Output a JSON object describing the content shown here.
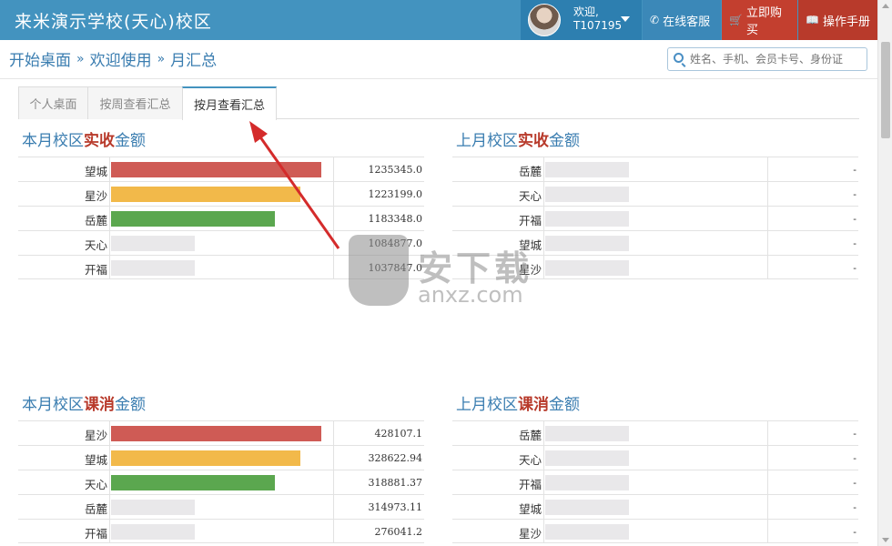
{
  "header": {
    "title": "来米演示学校(天心)校区",
    "welcome_line1": "欢迎,",
    "welcome_line2": "T107195",
    "buttons": {
      "service": "在线客服",
      "buy": "立即购买",
      "manual": "操作手册"
    }
  },
  "breadcrumb": {
    "items": [
      "开始桌面",
      "欢迎使用",
      "月汇总"
    ],
    "separator": "»"
  },
  "search": {
    "placeholder": "姓名、手机、会员卡号、身份证"
  },
  "tabs": [
    {
      "label": "个人桌面",
      "active": false
    },
    {
      "label": "按周查看汇总",
      "active": false
    },
    {
      "label": "按月查看汇总",
      "active": true
    }
  ],
  "colors": {
    "rank1": "#cf5b55",
    "rank2": "#f2b94a",
    "rank3": "#5ba74f",
    "empty": "#e9e8ea"
  },
  "panels": {
    "this_month_actual": {
      "title_pre": "本月校区",
      "title_hl": "实收",
      "title_post": "金额",
      "rows": [
        {
          "name": "望城",
          "value": "1235345.0",
          "level": 1.0,
          "rank": 1
        },
        {
          "name": "星沙",
          "value": "1223199.0",
          "level": 0.9,
          "rank": 2
        },
        {
          "name": "岳麓",
          "value": "1183348.0",
          "level": 0.78,
          "rank": 3
        },
        {
          "name": "天心",
          "value": "1084877.0",
          "level": 0.4,
          "rank": 0
        },
        {
          "name": "开福",
          "value": "1037847.0",
          "level": 0.4,
          "rank": 0
        }
      ]
    },
    "last_month_actual": {
      "title_pre": "上月校区",
      "title_hl": "实收",
      "title_post": "金额",
      "rows": [
        {
          "name": "岳麓",
          "value": "-",
          "level": 0.4,
          "rank": 0
        },
        {
          "name": "天心",
          "value": "-",
          "level": 0.4,
          "rank": 0
        },
        {
          "name": "开福",
          "value": "-",
          "level": 0.4,
          "rank": 0
        },
        {
          "name": "望城",
          "value": "-",
          "level": 0.4,
          "rank": 0
        },
        {
          "name": "星沙",
          "value": "-",
          "level": 0.4,
          "rank": 0
        }
      ]
    },
    "this_month_consume": {
      "title_pre": "本月校区",
      "title_hl": "课消",
      "title_post": "金额",
      "rows": [
        {
          "name": "星沙",
          "value": "428107.1",
          "level": 1.0,
          "rank": 1
        },
        {
          "name": "望城",
          "value": "328622.94",
          "level": 0.9,
          "rank": 2
        },
        {
          "name": "天心",
          "value": "318881.37",
          "level": 0.78,
          "rank": 3
        },
        {
          "name": "岳麓",
          "value": "314973.11",
          "level": 0.4,
          "rank": 0
        },
        {
          "name": "开福",
          "value": "276041.2",
          "level": 0.4,
          "rank": 0
        }
      ]
    },
    "last_month_consume": {
      "title_pre": "上月校区",
      "title_hl": "课消",
      "title_post": "金额",
      "rows": [
        {
          "name": "岳麓",
          "value": "-",
          "level": 0.4,
          "rank": 0
        },
        {
          "name": "天心",
          "value": "-",
          "level": 0.4,
          "rank": 0
        },
        {
          "name": "开福",
          "value": "-",
          "level": 0.4,
          "rank": 0
        },
        {
          "name": "望城",
          "value": "-",
          "level": 0.4,
          "rank": 0
        },
        {
          "name": "星沙",
          "value": "-",
          "level": 0.4,
          "rank": 0
        }
      ]
    }
  },
  "watermark": {
    "text1": "安下载",
    "text2": "anxz.com"
  }
}
